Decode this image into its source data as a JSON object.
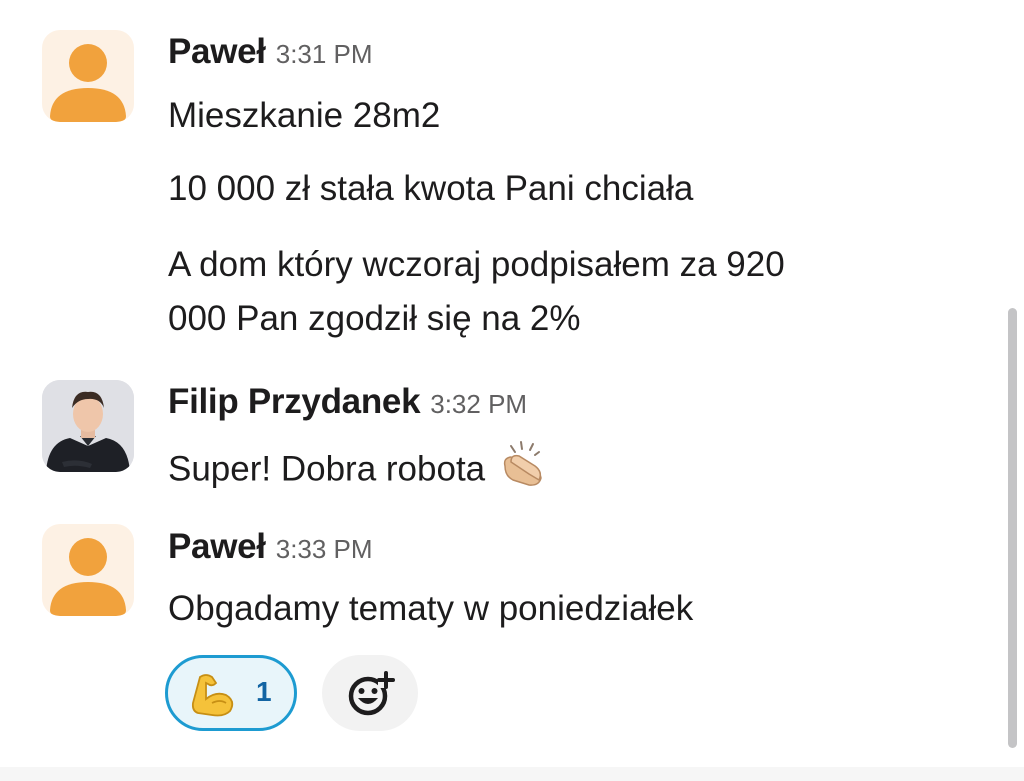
{
  "messages": [
    {
      "author": "Paweł",
      "time": "3:31 PM",
      "avatar": "default-user-avatar",
      "lines": [
        "Mieszkanie 28m2",
        "10 000 zł stała kwota Pani chciała",
        "A dom który wczoraj podpisałem za 920",
        "000 Pan zgodził się na 2%"
      ]
    },
    {
      "author": "Filip Przydanek",
      "time": "3:32 PM",
      "avatar": "user-photo-avatar",
      "lines": [
        "Super! Dobra robota"
      ],
      "inline_emoji": "clapping-hands-icon"
    },
    {
      "author": "Paweł",
      "time": "3:33 PM",
      "avatar": "default-user-avatar",
      "lines": [
        "Obgadamy tematy w poniedziałek"
      ],
      "reactions": [
        {
          "emoji": "flexed-biceps-icon",
          "count": "1",
          "selected": true
        }
      ],
      "add_reaction_icon": "add-emoji-icon"
    }
  ],
  "colors": {
    "avatar_bg": "#fdf1e4",
    "avatar_figure": "#f1a23d",
    "reaction_border": "#1d9bd1",
    "reaction_bg": "#e8f5fa",
    "reaction_count": "#1264a3",
    "timestamp": "#616061",
    "text": "#1d1c1d"
  }
}
